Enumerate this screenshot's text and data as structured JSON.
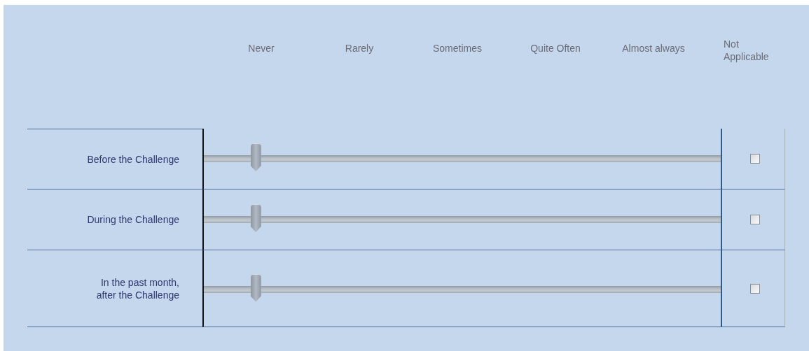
{
  "scale": [
    "Never",
    "Rarely",
    "Sometimes",
    "Quite Often",
    "Almost always"
  ],
  "na_header": "Not Applicable",
  "rows": [
    {
      "label": "Before the Challenge",
      "level": 0.1,
      "not_applicable": false
    },
    {
      "label": "During the Challenge",
      "level": 0.1,
      "not_applicable": false
    },
    {
      "label": "In the past month, after the Challenge",
      "level": 0.1,
      "not_applicable": false
    }
  ]
}
